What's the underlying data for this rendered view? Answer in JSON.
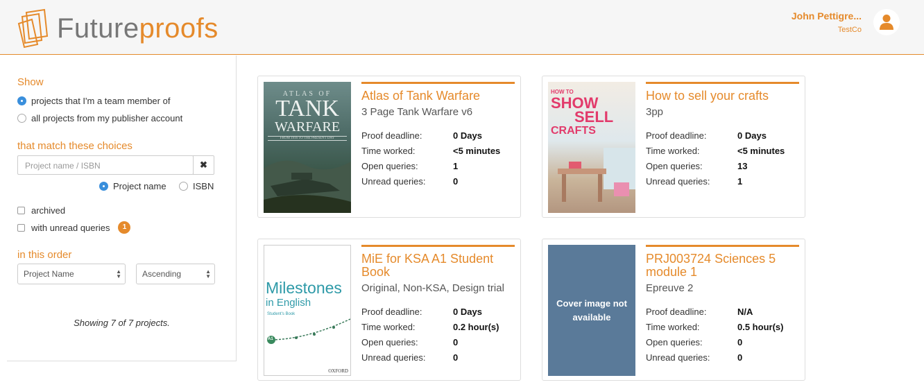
{
  "header": {
    "logo_text_a": "Future",
    "logo_text_b": "p",
    "logo_text_c": "roofs",
    "user_name": "John Pettigre...",
    "user_org": "TestCo",
    "accent": "#e58a2b"
  },
  "sidebar": {
    "show_title": "Show",
    "show_options": [
      "projects that I'm a team member of",
      "all projects from my publisher account"
    ],
    "match_title": "that match these choices",
    "search_placeholder": "Project name / ISBN",
    "search_value": "",
    "clear_icon": "✖",
    "search_by": [
      "Project name",
      "ISBN"
    ],
    "archived_label": "archived",
    "unread_label": "with unread queries",
    "unread_count": "1",
    "order_title": "in this order",
    "sort_field": "Project Name",
    "sort_dir": "Ascending",
    "showing": "Showing 7 of 7 projects."
  },
  "labels": {
    "deadline": "Proof deadline:",
    "worked": "Time worked:",
    "open": "Open queries:",
    "unread": "Unread queries:"
  },
  "projects": [
    {
      "title": "Atlas of Tank Warfare",
      "subtitle": "3 Page Tank Warfare v6",
      "deadline": "0 Days",
      "worked": "<5 minutes",
      "open": "1",
      "unread": "0",
      "cover": {
        "line1": "ATLAS OF",
        "line2": "TANK",
        "line3": "WARFARE",
        "line4": "FROM 1916 TO THE PRESENT DAY"
      }
    },
    {
      "title": "How to sell your crafts",
      "subtitle": "3pp",
      "deadline": "0 Days",
      "worked": "<5 minutes",
      "open": "13",
      "unread": "1",
      "cover": {
        "line1": "HOW TO",
        "line2": "SHOW",
        "line3": "SELL",
        "line4": "CRAFTS"
      }
    },
    {
      "title": "MiE for KSA A1 Student Book",
      "subtitle": "Original, Non-KSA, Design trial",
      "deadline": "0 Days",
      "worked": "0.2 hour(s)",
      "open": "0",
      "unread": "0",
      "cover": {
        "line1": "Milestones",
        "line2": "in English",
        "line3": "Student's Book",
        "line4": "A1",
        "line5": "OXFORD"
      }
    },
    {
      "title": "PRJ003724 Sciences 5 module 1",
      "subtitle": "Epreuve 2",
      "deadline": "N/A",
      "worked": "0.5 hour(s)",
      "open": "0",
      "unread": "0",
      "cover": {
        "no_cover": "Cover image not available"
      }
    }
  ]
}
